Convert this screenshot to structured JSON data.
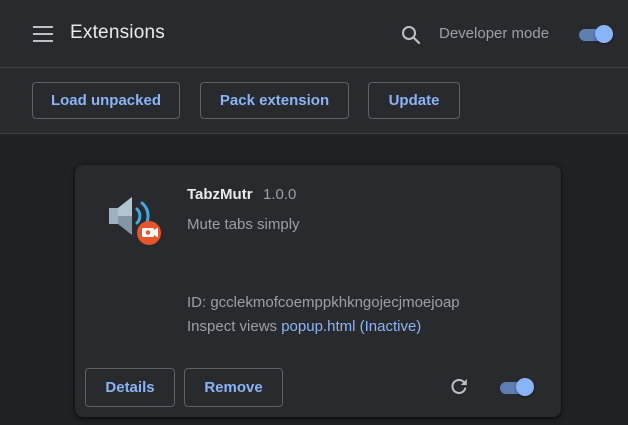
{
  "header": {
    "title": "Extensions",
    "search_icon": "search-icon",
    "menu_icon": "hamburger-menu-icon",
    "developer_mode_label": "Developer mode",
    "developer_mode_on": true
  },
  "toolbar": {
    "load_unpacked_label": "Load unpacked",
    "pack_extension_label": "Pack extension",
    "update_label": "Update"
  },
  "extension": {
    "name": "TabzMutr",
    "version": "1.0.0",
    "description": "Mute tabs simply",
    "id_text": "ID: gcclekmofcoemppkhkngojecjmoejoap",
    "inspect_label": "Inspect views",
    "inspect_link": "popup.html (Inactive)",
    "icon": "speaker-with-record-badge-icon",
    "details_label": "Details",
    "remove_label": "Remove",
    "reload_icon": "reload-icon",
    "enabled": true
  },
  "colors": {
    "background": "#202124",
    "surface": "#292a2d",
    "accent": "#8ab4f8",
    "text_primary": "#e8eaed",
    "text_secondary": "#9aa0a6",
    "border": "#5f6368",
    "badge": "#e8552b"
  }
}
